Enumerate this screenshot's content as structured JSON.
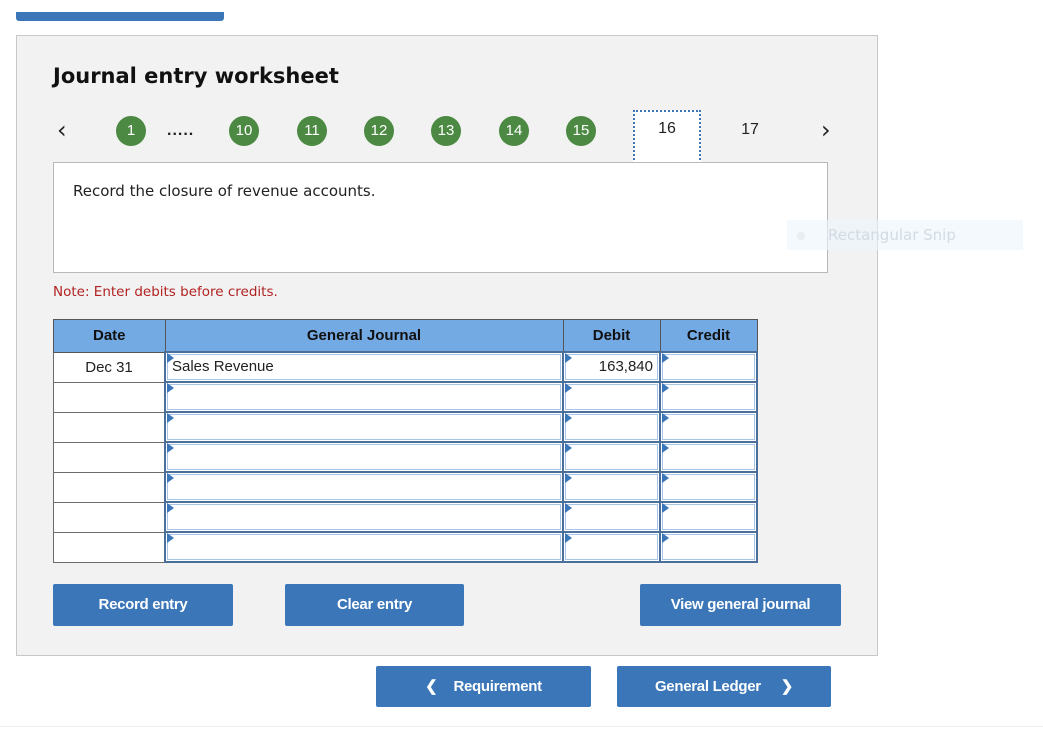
{
  "worksheet": {
    "title": "Journal entry worksheet",
    "nav": {
      "prev_icon": "chevron-left-icon",
      "next_icon": "chevron-right-icon",
      "completed_steps": [
        "1",
        "10",
        "11",
        "12",
        "13",
        "14",
        "15"
      ],
      "ellipsis": ".....",
      "current_step": "16",
      "upcoming_steps": [
        "17"
      ],
      "completed_color": "#4c8a43"
    },
    "question": "Record the closure of revenue accounts.",
    "note": "Note: Enter debits before credits."
  },
  "journal_table": {
    "headers": [
      "Date",
      "General Journal",
      "Debit",
      "Credit"
    ],
    "rows": [
      {
        "date": "Dec 31",
        "account": "Sales Revenue",
        "debit": "163,840",
        "credit": ""
      },
      {
        "date": "",
        "account": "",
        "debit": "",
        "credit": ""
      },
      {
        "date": "",
        "account": "",
        "debit": "",
        "credit": ""
      },
      {
        "date": "",
        "account": "",
        "debit": "",
        "credit": ""
      },
      {
        "date": "",
        "account": "",
        "debit": "",
        "credit": ""
      },
      {
        "date": "",
        "account": "",
        "debit": "",
        "credit": ""
      },
      {
        "date": "",
        "account": "",
        "debit": "",
        "credit": ""
      }
    ],
    "header_color": "#74aae3"
  },
  "buttons": {
    "record_entry": "Record entry",
    "clear_entry": "Clear entry",
    "view_general_journal": "View general journal",
    "requirement": "Requirement",
    "general_ledger": "General Ledger",
    "color": "#3a76b8"
  },
  "overlay": {
    "snip_label": "Rectangular Snip"
  }
}
